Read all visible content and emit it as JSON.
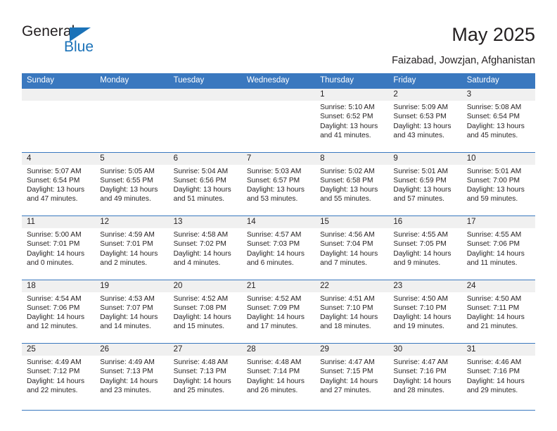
{
  "brand": {
    "name_part1": "General",
    "name_part2": "Blue",
    "accent_color": "#1b72b8"
  },
  "header": {
    "title": "May 2025",
    "location": "Faizabad, Jowzjan, Afghanistan"
  },
  "theme": {
    "header_bar_color": "#3a78bf",
    "day_band_color": "#f0f0f0",
    "text_color": "#231f20"
  },
  "weekdays": [
    "Sunday",
    "Monday",
    "Tuesday",
    "Wednesday",
    "Thursday",
    "Friday",
    "Saturday"
  ],
  "weeks": [
    [
      {
        "day": "",
        "sunrise": "",
        "sunset": "",
        "daylight1": "",
        "daylight2": ""
      },
      {
        "day": "",
        "sunrise": "",
        "sunset": "",
        "daylight1": "",
        "daylight2": ""
      },
      {
        "day": "",
        "sunrise": "",
        "sunset": "",
        "daylight1": "",
        "daylight2": ""
      },
      {
        "day": "",
        "sunrise": "",
        "sunset": "",
        "daylight1": "",
        "daylight2": ""
      },
      {
        "day": "1",
        "sunrise": "Sunrise: 5:10 AM",
        "sunset": "Sunset: 6:52 PM",
        "daylight1": "Daylight: 13 hours",
        "daylight2": "and 41 minutes."
      },
      {
        "day": "2",
        "sunrise": "Sunrise: 5:09 AM",
        "sunset": "Sunset: 6:53 PM",
        "daylight1": "Daylight: 13 hours",
        "daylight2": "and 43 minutes."
      },
      {
        "day": "3",
        "sunrise": "Sunrise: 5:08 AM",
        "sunset": "Sunset: 6:54 PM",
        "daylight1": "Daylight: 13 hours",
        "daylight2": "and 45 minutes."
      }
    ],
    [
      {
        "day": "4",
        "sunrise": "Sunrise: 5:07 AM",
        "sunset": "Sunset: 6:54 PM",
        "daylight1": "Daylight: 13 hours",
        "daylight2": "and 47 minutes."
      },
      {
        "day": "5",
        "sunrise": "Sunrise: 5:05 AM",
        "sunset": "Sunset: 6:55 PM",
        "daylight1": "Daylight: 13 hours",
        "daylight2": "and 49 minutes."
      },
      {
        "day": "6",
        "sunrise": "Sunrise: 5:04 AM",
        "sunset": "Sunset: 6:56 PM",
        "daylight1": "Daylight: 13 hours",
        "daylight2": "and 51 minutes."
      },
      {
        "day": "7",
        "sunrise": "Sunrise: 5:03 AM",
        "sunset": "Sunset: 6:57 PM",
        "daylight1": "Daylight: 13 hours",
        "daylight2": "and 53 minutes."
      },
      {
        "day": "8",
        "sunrise": "Sunrise: 5:02 AM",
        "sunset": "Sunset: 6:58 PM",
        "daylight1": "Daylight: 13 hours",
        "daylight2": "and 55 minutes."
      },
      {
        "day": "9",
        "sunrise": "Sunrise: 5:01 AM",
        "sunset": "Sunset: 6:59 PM",
        "daylight1": "Daylight: 13 hours",
        "daylight2": "and 57 minutes."
      },
      {
        "day": "10",
        "sunrise": "Sunrise: 5:01 AM",
        "sunset": "Sunset: 7:00 PM",
        "daylight1": "Daylight: 13 hours",
        "daylight2": "and 59 minutes."
      }
    ],
    [
      {
        "day": "11",
        "sunrise": "Sunrise: 5:00 AM",
        "sunset": "Sunset: 7:01 PM",
        "daylight1": "Daylight: 14 hours",
        "daylight2": "and 0 minutes."
      },
      {
        "day": "12",
        "sunrise": "Sunrise: 4:59 AM",
        "sunset": "Sunset: 7:01 PM",
        "daylight1": "Daylight: 14 hours",
        "daylight2": "and 2 minutes."
      },
      {
        "day": "13",
        "sunrise": "Sunrise: 4:58 AM",
        "sunset": "Sunset: 7:02 PM",
        "daylight1": "Daylight: 14 hours",
        "daylight2": "and 4 minutes."
      },
      {
        "day": "14",
        "sunrise": "Sunrise: 4:57 AM",
        "sunset": "Sunset: 7:03 PM",
        "daylight1": "Daylight: 14 hours",
        "daylight2": "and 6 minutes."
      },
      {
        "day": "15",
        "sunrise": "Sunrise: 4:56 AM",
        "sunset": "Sunset: 7:04 PM",
        "daylight1": "Daylight: 14 hours",
        "daylight2": "and 7 minutes."
      },
      {
        "day": "16",
        "sunrise": "Sunrise: 4:55 AM",
        "sunset": "Sunset: 7:05 PM",
        "daylight1": "Daylight: 14 hours",
        "daylight2": "and 9 minutes."
      },
      {
        "day": "17",
        "sunrise": "Sunrise: 4:55 AM",
        "sunset": "Sunset: 7:06 PM",
        "daylight1": "Daylight: 14 hours",
        "daylight2": "and 11 minutes."
      }
    ],
    [
      {
        "day": "18",
        "sunrise": "Sunrise: 4:54 AM",
        "sunset": "Sunset: 7:06 PM",
        "daylight1": "Daylight: 14 hours",
        "daylight2": "and 12 minutes."
      },
      {
        "day": "19",
        "sunrise": "Sunrise: 4:53 AM",
        "sunset": "Sunset: 7:07 PM",
        "daylight1": "Daylight: 14 hours",
        "daylight2": "and 14 minutes."
      },
      {
        "day": "20",
        "sunrise": "Sunrise: 4:52 AM",
        "sunset": "Sunset: 7:08 PM",
        "daylight1": "Daylight: 14 hours",
        "daylight2": "and 15 minutes."
      },
      {
        "day": "21",
        "sunrise": "Sunrise: 4:52 AM",
        "sunset": "Sunset: 7:09 PM",
        "daylight1": "Daylight: 14 hours",
        "daylight2": "and 17 minutes."
      },
      {
        "day": "22",
        "sunrise": "Sunrise: 4:51 AM",
        "sunset": "Sunset: 7:10 PM",
        "daylight1": "Daylight: 14 hours",
        "daylight2": "and 18 minutes."
      },
      {
        "day": "23",
        "sunrise": "Sunrise: 4:50 AM",
        "sunset": "Sunset: 7:10 PM",
        "daylight1": "Daylight: 14 hours",
        "daylight2": "and 19 minutes."
      },
      {
        "day": "24",
        "sunrise": "Sunrise: 4:50 AM",
        "sunset": "Sunset: 7:11 PM",
        "daylight1": "Daylight: 14 hours",
        "daylight2": "and 21 minutes."
      }
    ],
    [
      {
        "day": "25",
        "sunrise": "Sunrise: 4:49 AM",
        "sunset": "Sunset: 7:12 PM",
        "daylight1": "Daylight: 14 hours",
        "daylight2": "and 22 minutes."
      },
      {
        "day": "26",
        "sunrise": "Sunrise: 4:49 AM",
        "sunset": "Sunset: 7:13 PM",
        "daylight1": "Daylight: 14 hours",
        "daylight2": "and 23 minutes."
      },
      {
        "day": "27",
        "sunrise": "Sunrise: 4:48 AM",
        "sunset": "Sunset: 7:13 PM",
        "daylight1": "Daylight: 14 hours",
        "daylight2": "and 25 minutes."
      },
      {
        "day": "28",
        "sunrise": "Sunrise: 4:48 AM",
        "sunset": "Sunset: 7:14 PM",
        "daylight1": "Daylight: 14 hours",
        "daylight2": "and 26 minutes."
      },
      {
        "day": "29",
        "sunrise": "Sunrise: 4:47 AM",
        "sunset": "Sunset: 7:15 PM",
        "daylight1": "Daylight: 14 hours",
        "daylight2": "and 27 minutes."
      },
      {
        "day": "30",
        "sunrise": "Sunrise: 4:47 AM",
        "sunset": "Sunset: 7:16 PM",
        "daylight1": "Daylight: 14 hours",
        "daylight2": "and 28 minutes."
      },
      {
        "day": "31",
        "sunrise": "Sunrise: 4:46 AM",
        "sunset": "Sunset: 7:16 PM",
        "daylight1": "Daylight: 14 hours",
        "daylight2": "and 29 minutes."
      }
    ]
  ]
}
